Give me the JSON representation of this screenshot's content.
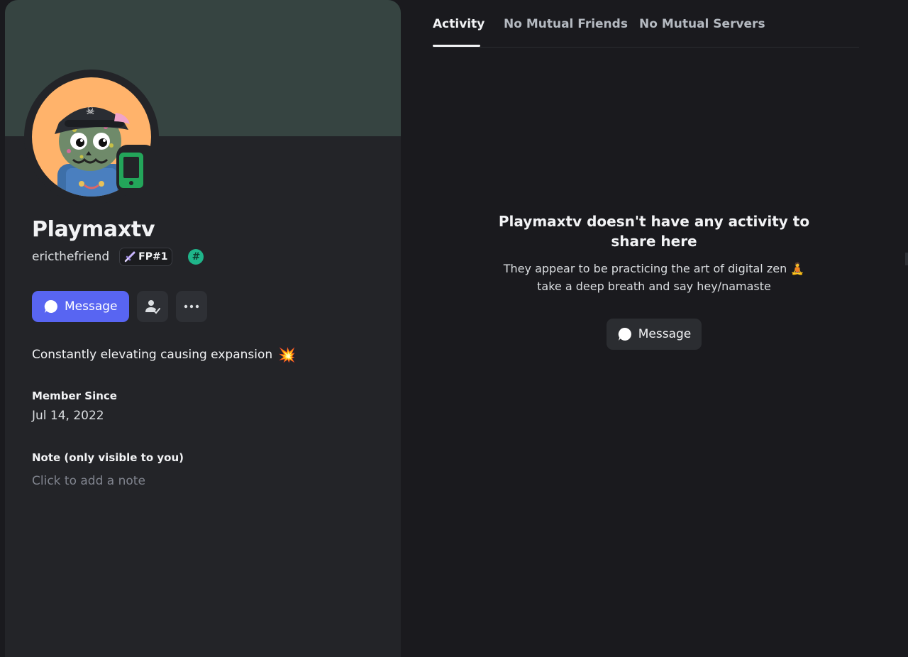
{
  "profile": {
    "display_name": "Playmaxtv",
    "username": "ericthefriend",
    "server_tag": "FP#1",
    "bio": "Constantly elevating causing expansion",
    "bio_emoji": "💥",
    "member_since_label": "Member Since",
    "member_since_value": "Jul 14, 2022",
    "note_label": "Note (only visible to you)",
    "note_placeholder": "Click to add a note",
    "status": "mobile-online",
    "colors": {
      "banner": "#364441",
      "avatar_bg": "#ffb36b",
      "status_green": "#23a55a",
      "hash_badge": "#1fb58a",
      "accent": "#5865f2"
    }
  },
  "actions": {
    "message_label": "Message",
    "friend_icon": "add-friend-icon",
    "more_icon": "more-options-icon"
  },
  "tabs": [
    {
      "label": "Activity",
      "active": true
    },
    {
      "label": "No Mutual Friends",
      "active": false
    },
    {
      "label": "No Mutual Servers",
      "active": false
    }
  ],
  "activity": {
    "empty_title": "Playmaxtv doesn't have any activity to share here",
    "empty_subtitle": "They appear to be practicing the art of digital zen",
    "empty_subtitle_emoji": "🧘",
    "empty_subtitle_line2": "take a deep breath and say hey/namaste",
    "message_label": "Message"
  }
}
